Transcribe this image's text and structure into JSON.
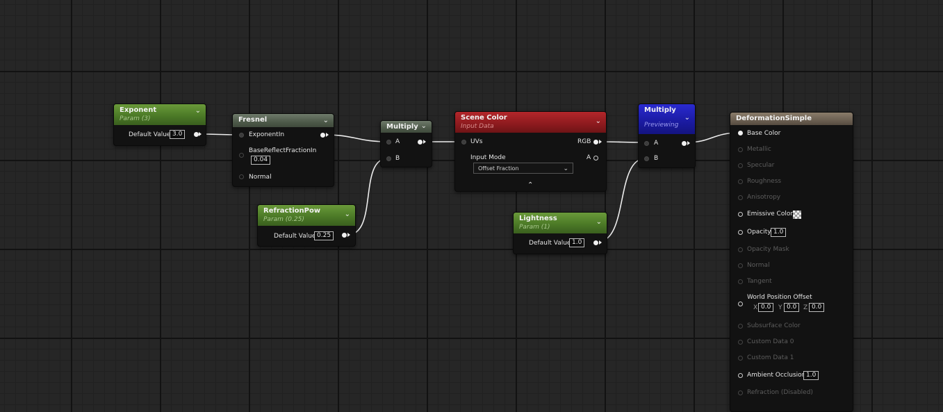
{
  "nodes": {
    "exponent": {
      "title": "Exponent",
      "subtitle": "Param (3)",
      "default_label": "Default Value",
      "default_value": "3.0"
    },
    "fresnel": {
      "title": "Fresnel",
      "exponent_in": "ExponentIn",
      "base_reflect": "BaseReflectFractionIn",
      "base_reflect_value": "0.04",
      "normal": "Normal"
    },
    "multiply1": {
      "title": "Multiply",
      "a": "A",
      "b": "B"
    },
    "refraction_pow": {
      "title": "RefractionPow",
      "subtitle": "Param (0.25)",
      "default_label": "Default Value",
      "default_value": "0.25"
    },
    "scene_color": {
      "title": "Scene Color",
      "subtitle": "Input Data",
      "uvs": "UVs",
      "rgb": "RGB",
      "input_mode_label": "Input Mode",
      "a_out": "A",
      "input_mode_value": "Offset Fraction"
    },
    "multiply2": {
      "title": "Multiply",
      "subtitle": "Previewing",
      "a": "A",
      "b": "B"
    },
    "lightness": {
      "title": "Lightness",
      "subtitle": "Param (1)",
      "default_label": "Default Value",
      "default_value": "1.0"
    },
    "result": {
      "title": "DeformationSimple",
      "base_color": "Base Color",
      "metallic": "Metallic",
      "specular": "Specular",
      "roughness": "Roughness",
      "anisotropy": "Anisotropy",
      "emissive": "Emissive Color",
      "opacity": "Opacity",
      "opacity_value": "1.0",
      "opacity_mask": "Opacity Mask",
      "normal": "Normal",
      "tangent": "Tangent",
      "wpo": "World Position Offset",
      "wpo_x_label": "X",
      "wpo_x": "0.0",
      "wpo_y_label": "Y",
      "wpo_y": "0.0",
      "wpo_z_label": "Z",
      "wpo_z": "0.0",
      "subsurface": "Subsurface Color",
      "custom0": "Custom Data 0",
      "custom1": "Custom Data 1",
      "ao": "Ambient Occlusion",
      "ao_value": "1.0",
      "refraction": "Refraction (Disabled)"
    }
  },
  "icons": {
    "collapse": "chevron-down-icon",
    "expand_advanced": "chevron-up-icon",
    "emissive_swatch": "checker-swatch-icon"
  },
  "colors": {
    "param_header": "#4c7a27",
    "function_header": "#4e5a4a",
    "scene_color_header": "#8c1a1e",
    "preview_header": "#1a1aa0",
    "result_header": "#6c6052",
    "wire": "#f0f0f0"
  }
}
